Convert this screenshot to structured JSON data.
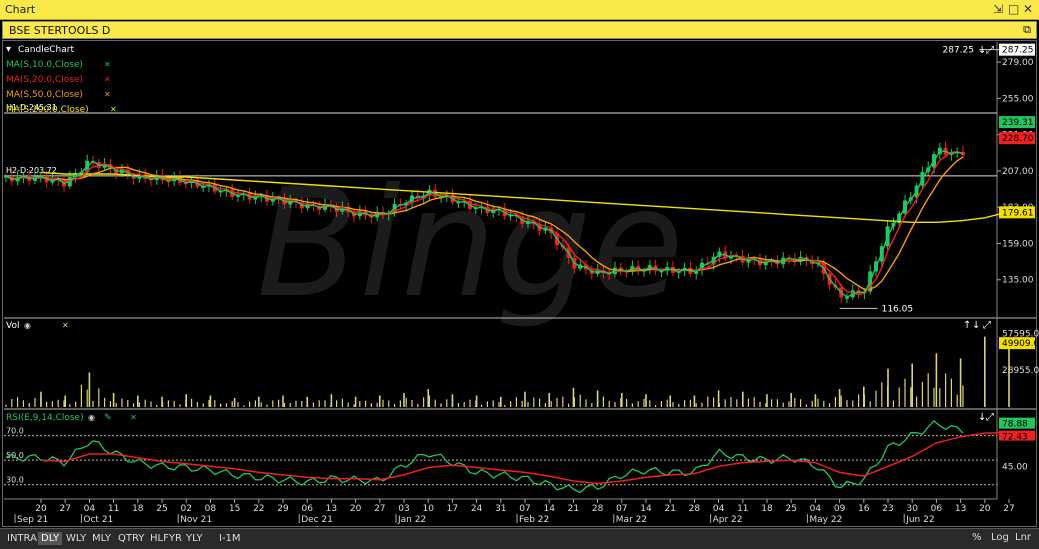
{
  "window": {
    "title": "Chart",
    "pin_icon": "pin-icon",
    "maximize_icon": "maximize-icon",
    "close_icon": "close-icon"
  },
  "symbol_bar": {
    "title": "BSE STERTOOLS D",
    "restore_icon": "restore-icon"
  },
  "legend": {
    "candle": "CandleChart",
    "ma10": "MA(S,10.0,Close)",
    "ma20": "MA(S,20.0,Close)",
    "ma50": "MA(S,50.0,Close)",
    "ma200": "MA(S,200.0,Close)",
    "h1": "H1-D:245.31",
    "h2": "H2-D:203.72",
    "vol": "Vol",
    "rsi": "RSI(E,9,14,Close)",
    "watermark": "Binge"
  },
  "colors": {
    "ma10": "#22c55e",
    "ma20": "#ef2020",
    "ma50": "#f59e0b",
    "ma200": "#f2e100",
    "up": "#22c55e",
    "down": "#ef2020",
    "volume": "#ddd37a"
  },
  "price_axis": {
    "ticks": [
      "279.00",
      "255.00",
      "231.00",
      "207.00",
      "183.00",
      "159.00",
      "135.00"
    ],
    "labels": {
      "last": "287.25",
      "ma10": "239.31",
      "ma20": "228.70",
      "ma200": "179.61"
    }
  },
  "volume_axis": {
    "ticks": [
      "57595.0",
      "28955.0"
    ],
    "label": "49909.0"
  },
  "rsi_axis": {
    "ticks": [
      "45.00"
    ],
    "labels": {
      "rsi": "78.88",
      "signal": "72.43"
    },
    "levels": [
      "70.0",
      "50.0",
      "30.0"
    ]
  },
  "annotations": {
    "high": "287.25",
    "low": "116.05"
  },
  "x_axis": {
    "days": [
      "20",
      "27",
      "04",
      "11",
      "18",
      "25",
      "02",
      "08",
      "15",
      "22",
      "29",
      "06",
      "13",
      "20",
      "27",
      "03",
      "10",
      "17",
      "24",
      "31",
      "07",
      "14",
      "21",
      "28",
      "07",
      "14",
      "21",
      "28",
      "04",
      "11",
      "18",
      "25",
      "04",
      "09",
      "16",
      "23",
      "30",
      "06",
      "13",
      "20",
      "27"
    ],
    "months": [
      "Sep 21",
      "Oct 21",
      "Nov 21",
      "Dec 21",
      "Jan 22",
      "Feb 22",
      "Mar 22",
      "Apr 22",
      "May 22",
      "Jun 22"
    ]
  },
  "toolbar": {
    "periods": [
      "INTRA",
      "DLY",
      "WLY",
      "MLY",
      "QTRY",
      "HLFYR",
      "YLY"
    ],
    "active": "DLY",
    "interval": "I-1M",
    "right": [
      "%",
      "Log",
      "Lnr"
    ]
  },
  "chart_data": {
    "type": "candlestick",
    "symbol": "BSE STERTOOLS D",
    "x": [
      "2021-09-20",
      "2021-09-27",
      "2021-10-04",
      "2021-10-11",
      "2021-10-18",
      "2021-10-25",
      "2021-11-02",
      "2021-11-08",
      "2021-11-15",
      "2021-11-22",
      "2021-11-29",
      "2021-12-06",
      "2021-12-13",
      "2021-12-20",
      "2021-12-27",
      "2022-01-03",
      "2022-01-10",
      "2022-01-17",
      "2022-01-24",
      "2022-01-31",
      "2022-02-07",
      "2022-02-14",
      "2022-02-21",
      "2022-02-28",
      "2022-03-07",
      "2022-03-14",
      "2022-03-21",
      "2022-03-28",
      "2022-04-04",
      "2022-04-11",
      "2022-04-18",
      "2022-04-25",
      "2022-05-04",
      "2022-05-09",
      "2022-05-16",
      "2022-05-23",
      "2022-05-30",
      "2022-06-06",
      "2022-06-13",
      "2022-06-20",
      "2022-06-27"
    ],
    "close": [
      201,
      199,
      215,
      209,
      202,
      200,
      199,
      197,
      193,
      190,
      186,
      182,
      183,
      180,
      179,
      186,
      191,
      187,
      183,
      182,
      174,
      166,
      143,
      139,
      143,
      144,
      141,
      139,
      151,
      149,
      148,
      150,
      146,
      122,
      127,
      170,
      194,
      221,
      216,
      236,
      287
    ],
    "ma200": [
      206,
      205,
      205,
      205,
      204,
      203,
      203,
      202,
      201,
      200,
      199,
      198,
      197,
      196,
      195,
      194,
      193,
      192,
      191,
      190,
      189,
      188,
      187,
      186,
      185,
      184,
      183,
      182,
      181,
      180,
      179,
      178,
      177,
      176,
      175,
      174,
      173,
      173,
      174,
      176,
      180
    ],
    "volume": [
      12000,
      9000,
      27000,
      11000,
      9000,
      8000,
      10000,
      9000,
      7000,
      8000,
      9000,
      8000,
      10000,
      8000,
      9000,
      11000,
      14000,
      10000,
      9000,
      8000,
      12000,
      11000,
      15000,
      13000,
      11000,
      10000,
      9000,
      9000,
      13000,
      12000,
      10000,
      11000,
      10000,
      14000,
      16000,
      30000,
      34000,
      42000,
      38000,
      55000,
      49909
    ],
    "rsi": [
      52,
      48,
      66,
      56,
      48,
      45,
      44,
      42,
      38,
      36,
      34,
      32,
      35,
      34,
      33,
      46,
      56,
      48,
      40,
      38,
      35,
      30,
      26,
      28,
      38,
      42,
      40,
      40,
      56,
      52,
      50,
      52,
      46,
      28,
      34,
      60,
      70,
      80,
      74,
      78,
      78.88
    ],
    "rsi_signal": [
      50,
      49,
      55,
      55,
      52,
      49,
      47,
      45,
      43,
      40,
      38,
      36,
      35,
      35,
      34,
      38,
      44,
      46,
      44,
      42,
      40,
      37,
      33,
      31,
      33,
      36,
      38,
      39,
      45,
      48,
      49,
      50,
      48,
      40,
      37,
      45,
      53,
      64,
      69,
      72,
      72.43
    ],
    "ylim_price": [
      111,
      291
    ],
    "ylim_volume": [
      0,
      68000
    ],
    "ylim_rsi": [
      20,
      90
    ],
    "h_lines": [
      245.31,
      203.72
    ],
    "high_label": 287.25,
    "low_label": 116.05,
    "rsi_levels": [
      70,
      50,
      30
    ]
  }
}
